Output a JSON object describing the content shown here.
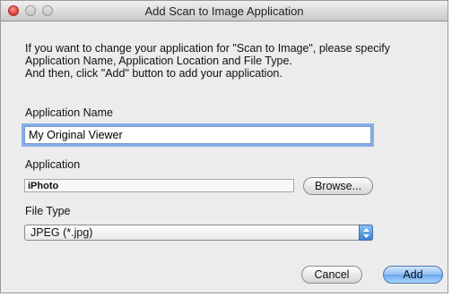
{
  "window": {
    "title": "Add Scan to Image Application"
  },
  "instructions": [
    "If you want to change your application for \"Scan to Image\", please specify",
    "Application Name, Application Location and File Type.",
    "And then, click \"Add\" button to add your application."
  ],
  "app_name": {
    "label": "Application Name",
    "value": "My Original Viewer"
  },
  "application": {
    "label": "Application",
    "value": "iPhoto",
    "browse_label": "Browse..."
  },
  "file_type": {
    "label": "File Type",
    "selected": "JPEG (*.jpg)"
  },
  "buttons": {
    "cancel": "Cancel",
    "add": "Add"
  }
}
